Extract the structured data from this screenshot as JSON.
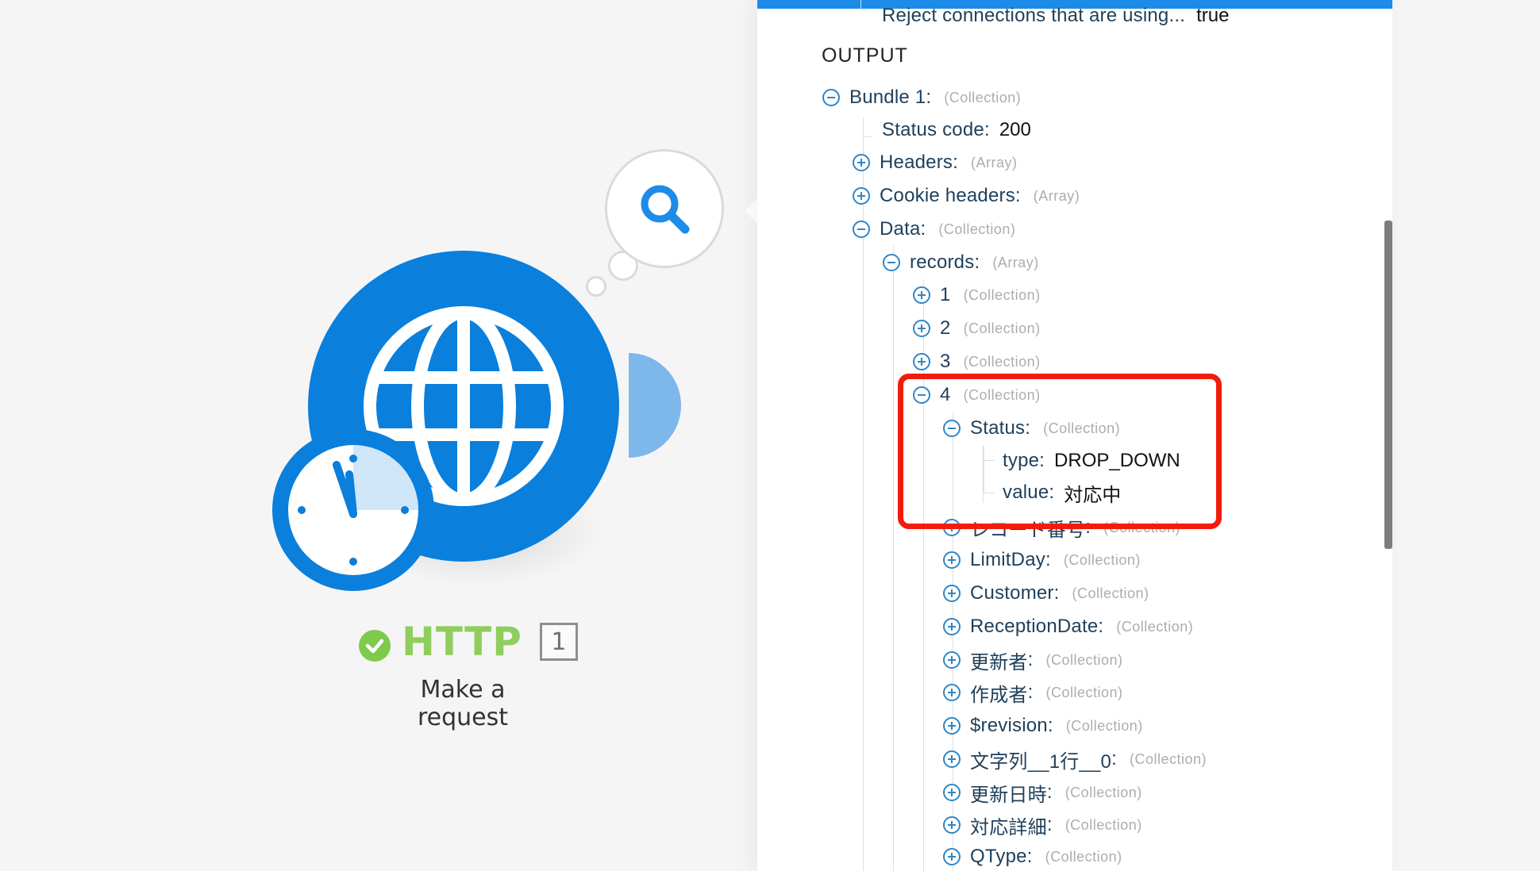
{
  "module": {
    "name": "HTTP",
    "operation_count": "1",
    "subtitle": "Make a request",
    "icon": "globe-icon",
    "scheduler_icon": "clock-icon",
    "status_icon": "check-circle-icon",
    "brand_color": "#0a7fdc",
    "status_color": "#8fce5e"
  },
  "inspector": {
    "icon": "search-icon",
    "truncated_row": {
      "key": "Reject connections that are using...",
      "value": "true"
    },
    "section_title": "OUTPUT",
    "tree": [
      {
        "key": "Bundle 1",
        "type": "(Collection)",
        "toggle": "minus"
      },
      {
        "key": "Status code",
        "value": "200"
      },
      {
        "key": "Headers",
        "type": "(Array)",
        "toggle": "plus"
      },
      {
        "key": "Cookie headers",
        "type": "(Array)",
        "toggle": "plus"
      },
      {
        "key": "Data",
        "type": "(Collection)",
        "toggle": "minus"
      },
      {
        "key": "records",
        "type": "(Array)",
        "toggle": "minus"
      },
      {
        "key": "1",
        "type": "(Collection)",
        "toggle": "plus"
      },
      {
        "key": "2",
        "type": "(Collection)",
        "toggle": "plus"
      },
      {
        "key": "3",
        "type": "(Collection)",
        "toggle": "plus"
      },
      {
        "key": "4",
        "type": "(Collection)",
        "toggle": "minus"
      },
      {
        "key": "Status",
        "type": "(Collection)",
        "toggle": "minus"
      },
      {
        "key": "type",
        "value": "DROP_DOWN"
      },
      {
        "key": "value",
        "value": "対応中"
      },
      {
        "key": "レコード番号",
        "type": "(Collection)",
        "toggle": "plus"
      },
      {
        "key": "LimitDay",
        "type": "(Collection)",
        "toggle": "plus"
      },
      {
        "key": "Customer",
        "type": "(Collection)",
        "toggle": "plus"
      },
      {
        "key": "ReceptionDate",
        "type": "(Collection)",
        "toggle": "plus"
      },
      {
        "key": "更新者",
        "type": "(Collection)",
        "toggle": "plus"
      },
      {
        "key": "作成者",
        "type": "(Collection)",
        "toggle": "plus"
      },
      {
        "key": "$revision",
        "type": "(Collection)",
        "toggle": "plus"
      },
      {
        "key": "文字列__1行__0",
        "type": "(Collection)",
        "toggle": "plus"
      },
      {
        "key": "更新日時",
        "type": "(Collection)",
        "toggle": "plus"
      },
      {
        "key": "対応詳細",
        "type": "(Collection)",
        "toggle": "plus"
      },
      {
        "key": "QType",
        "type": "(Collection)",
        "toggle": "plus"
      }
    ]
  },
  "annotation": {
    "color": "#f21c0d"
  }
}
